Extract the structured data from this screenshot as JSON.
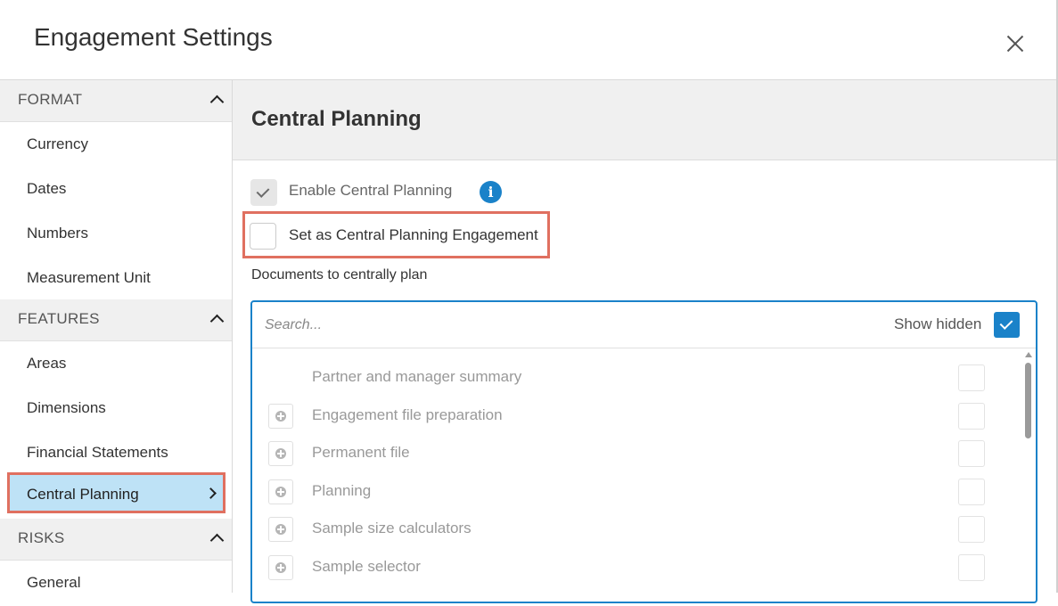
{
  "dialog": {
    "title": "Engagement Settings",
    "close_icon": "close-icon"
  },
  "sidebar": {
    "sections": [
      {
        "title": "FORMAT",
        "items": [
          "Currency",
          "Dates",
          "Numbers",
          "Measurement Unit"
        ]
      },
      {
        "title": "FEATURES",
        "items": [
          "Areas",
          "Dimensions",
          "Financial Statements",
          "Central Planning"
        ]
      },
      {
        "title": "RISKS",
        "items": [
          "General"
        ]
      }
    ],
    "active_item": "Central Planning"
  },
  "content": {
    "title": "Central Planning",
    "enable_label": "Enable Central Planning",
    "enable_checked": true,
    "set_engagement_label": "Set as Central Planning Engagement",
    "set_engagement_checked": false,
    "documents_label": "Documents to centrally plan",
    "search_placeholder": "Search...",
    "show_hidden_label": "Show hidden",
    "show_hidden_checked": true,
    "documents": [
      {
        "name": "Partner and manager summary",
        "expandable": false
      },
      {
        "name": "Engagement file preparation",
        "expandable": true
      },
      {
        "name": "Permanent file",
        "expandable": true
      },
      {
        "name": "Planning",
        "expandable": true
      },
      {
        "name": "Sample size calculators",
        "expandable": true
      },
      {
        "name": "Sample selector",
        "expandable": true
      }
    ]
  },
  "colors": {
    "accent": "#1a82c9",
    "active_nav_bg": "#bee2f6",
    "highlight_border": "#e07060"
  }
}
